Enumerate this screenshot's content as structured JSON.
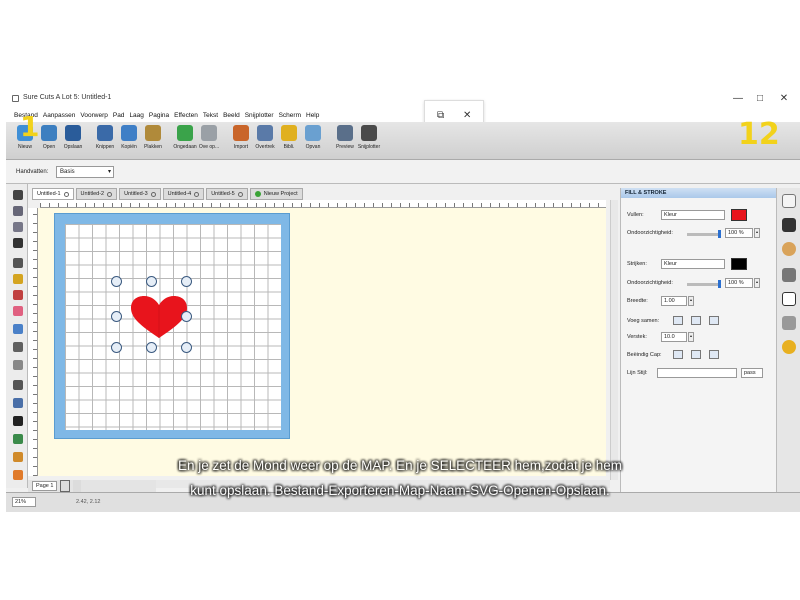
{
  "window": {
    "title": "Sure Cuts A Lot 5: Untitled-1",
    "controls": {
      "minimize": "—",
      "maximize": "□",
      "close": "✕"
    }
  },
  "popup": {
    "restore": "⧉",
    "close": "✕"
  },
  "menu": [
    "Bestand",
    "Aanpassen",
    "Voorwerp",
    "Pad",
    "Laag",
    "Pagina",
    "Effecten",
    "Tekst",
    "Beeld",
    "Snijplotter",
    "Scherm",
    "Help"
  ],
  "toolbar": {
    "buttons": [
      {
        "label": "Nieuw",
        "icon": "new-file-icon",
        "color": "#3f8fd6"
      },
      {
        "label": "Open",
        "icon": "open-folder-icon",
        "color": "#3d7fc0"
      },
      {
        "label": "Opslaan",
        "icon": "save-disk-icon",
        "color": "#2a5c9a"
      },
      {
        "label": "Knippen",
        "icon": "scissors-icon",
        "color": "#3a6aa8"
      },
      {
        "label": "Kopiën",
        "icon": "copy-icon",
        "color": "#3f7fc6"
      },
      {
        "label": "Plakken",
        "icon": "paste-icon",
        "color": "#b08a3a"
      },
      {
        "label": "Ongedaan",
        "icon": "undo-icon",
        "color": "#3aa34a"
      },
      {
        "label": "Ove op...",
        "icon": "redo-icon",
        "color": "#9aa0a6"
      },
      {
        "label": "Import",
        "icon": "import-icon",
        "color": "#c9652a"
      },
      {
        "label": "Overtrek",
        "icon": "trace-icon",
        "color": "#5a7aa8"
      },
      {
        "label": "Bibli.",
        "icon": "library-star-icon",
        "color": "#e0b020"
      },
      {
        "label": "Opvan",
        "icon": "mat-icon",
        "color": "#6aa0d0"
      },
      {
        "label": "Preview",
        "icon": "preview-magnifier-icon",
        "color": "#5a6f8a"
      },
      {
        "label": "Snijplotter",
        "icon": "cutter-knife-icon",
        "color": "#4a4a4a"
      }
    ]
  },
  "options": {
    "handles_label": "Handvatten:",
    "handles_value": "Basis"
  },
  "tabs": [
    {
      "label": "Untitled-1",
      "active": true
    },
    {
      "label": "Untitled-2",
      "active": false
    },
    {
      "label": "Untitled-3",
      "active": false
    },
    {
      "label": "Untitled-4",
      "active": false
    },
    {
      "label": "Untitled-5",
      "active": false
    },
    {
      "label": "Nieuw Project",
      "active": false,
      "new": true
    }
  ],
  "pagebar": {
    "page": "Page 1"
  },
  "status": {
    "zoom": "21%",
    "coords": "2.42, 2.12"
  },
  "panel": {
    "title": "FILL & STROKE",
    "fill_label": "Vullen:",
    "fill_type": "Kleur",
    "fill_color": "#e8141c",
    "fill_opacity_label": "Ondoorzichtigheid:",
    "fill_opacity": "100 %",
    "stroke_label": "Strijken:",
    "stroke_type": "Kleur",
    "stroke_color": "#000000",
    "stroke_opacity_label": "Ondoorzichtigheid:",
    "stroke_opacity": "100 %",
    "width_label": "Breedte:",
    "width_value": "1.00",
    "join_label": "Voeg samen:",
    "miter_label": "Verstek:",
    "miter_value": "10.0",
    "cap_label": "Beëindig Cap:",
    "style_label": "Lijn Stijl:",
    "style_button": "pass"
  },
  "overlay": {
    "annotation_left": "1",
    "annotation_right": "12",
    "subtitle_line1": "En je zet de Mond weer op de MAP. En je SELECTEER hem,zodat je hem",
    "subtitle_line2": "kunt opslaan. Bestand-Exporteren-Map-Naam-SVG-Openen-Opslaan."
  },
  "colors": {
    "mat": "#7fb8e6",
    "canvas": "#fffbe3",
    "heart": "#e8141c"
  }
}
